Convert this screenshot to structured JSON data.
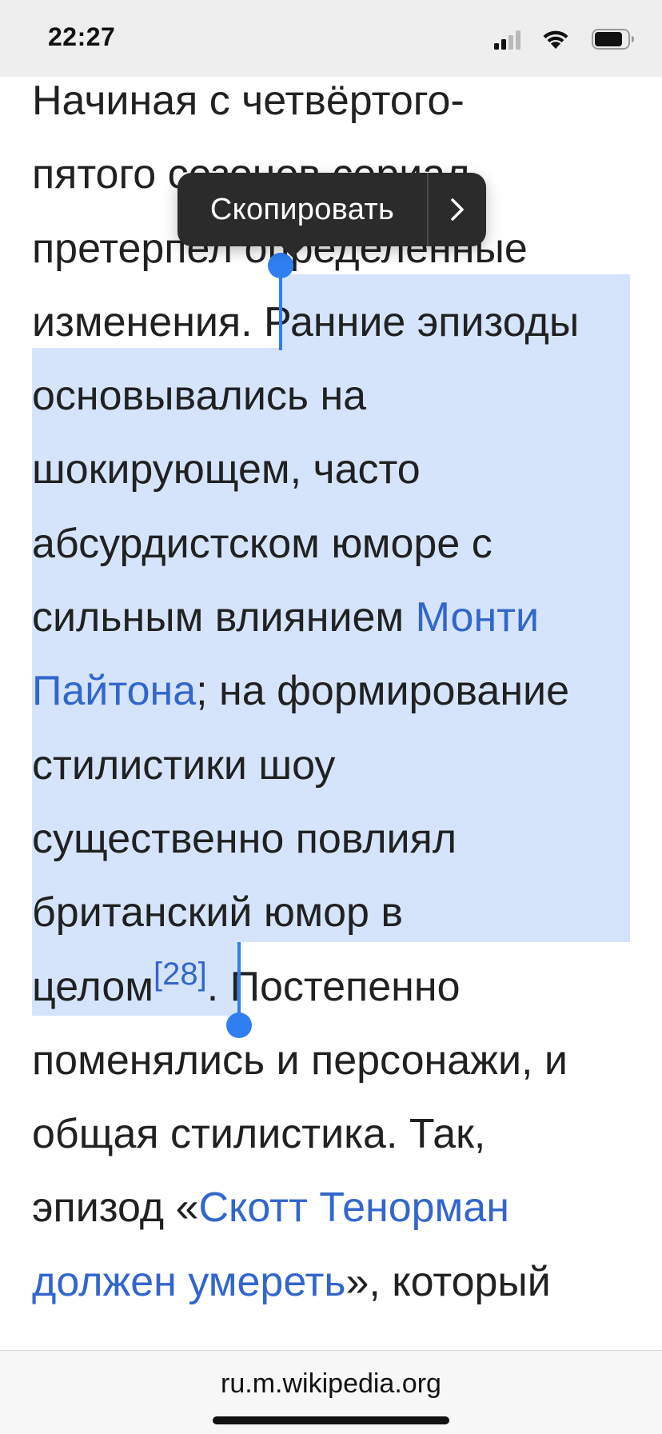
{
  "status_bar": {
    "time": "22:27",
    "icons": [
      "cellular-signal-icon",
      "wifi-icon",
      "battery-icon"
    ]
  },
  "edit_menu": {
    "copy_label": "Скопировать",
    "more_icon": "chevron-right-icon"
  },
  "article": {
    "lines": {
      "l1": "Начиная с четвёртого-",
      "l2": "пятого сезонов сериал",
      "l3": "претерпел определенные",
      "l4a": "изменения. ",
      "l4b": "Ранние эпизоды",
      "l5": "основывались на",
      "l6": "шокирующем, часто",
      "l7": "абсурдистском юморе с",
      "l8a": "сильным влиянием ",
      "l8_link": "Монти",
      "l9_link": "Пайтона",
      "l9b": "; на формирование",
      "l10": "стилистики шоу",
      "l11": "существенно повлиял",
      "l12": "британский юмор в",
      "l13a": "целом",
      "l13_ref": "[28]",
      "l13b": ". Постепенно",
      "l14": "поменялись и персонажи, и",
      "l15": "общая стилистика. Так,",
      "l16a": "эпизод «",
      "l16_link": "Скотт Тенорман",
      "l17_link": "должен умереть",
      "l17b": "», который"
    }
  },
  "url_bar": {
    "url": "ru.m.wikipedia.org"
  },
  "colors": {
    "link": "#3366cc",
    "selection": "#d6e4fb",
    "selection_handle": "#2f7ff2",
    "menu_background": "#2b2b2b"
  }
}
